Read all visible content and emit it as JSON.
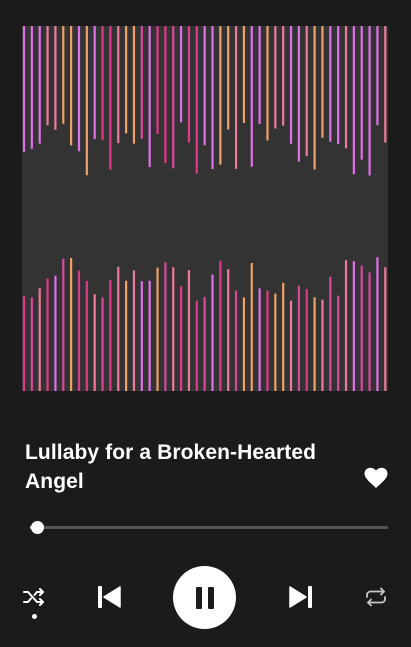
{
  "track": {
    "title": "Lullaby for a Broken-Hearted Angel",
    "liked": true,
    "progress_fraction": 0.02
  },
  "controls": {
    "shuffle_active": true,
    "state": "playing"
  },
  "icons": {
    "like": "heart-icon",
    "shuffle": "shuffle-icon",
    "previous": "skip-previous-icon",
    "play_pause": "pause-icon",
    "next": "skip-next-icon",
    "repeat": "repeat-icon"
  },
  "colors": {
    "background": "#1b1b1b",
    "artwork_background": "#333333",
    "accent": "#ffffff",
    "track": "#555555",
    "bar_palette": [
      "#f0a068",
      "#e0388a",
      "#e070e8",
      "#f07a9a",
      "#d8489c"
    ]
  }
}
